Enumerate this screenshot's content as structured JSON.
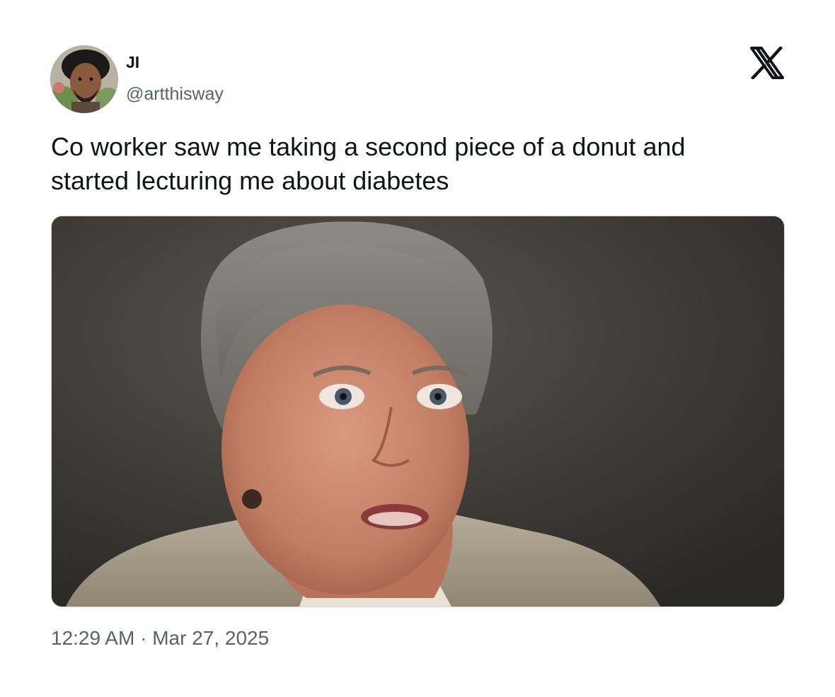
{
  "author": {
    "display_name": "JI",
    "handle": "@artthisway"
  },
  "tweet": {
    "text": "Co worker saw me taking a second piece of a donut and\nstarted lecturing me about diabetes",
    "time": "12:29 AM",
    "separator": " · ",
    "date": "Mar 27, 2025"
  },
  "icons": {
    "brand": "x-logo-icon",
    "avatar": "avatar-photo"
  },
  "colors": {
    "text_primary": "#0f1419",
    "text_secondary": "#536471",
    "media_border": "#cfd9de"
  }
}
